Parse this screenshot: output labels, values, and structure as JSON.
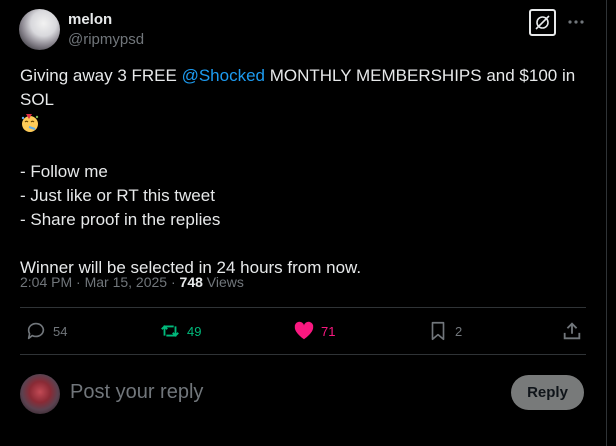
{
  "author": {
    "name": "melon",
    "handle": "@ripmypsd"
  },
  "tweet": {
    "line1_before": "Giving away 3 FREE ",
    "mention": "@Shocked",
    "line1_after": " MONTHLY MEMBERSHIPS and $100 in SOL",
    "bullet1": "- Follow me",
    "bullet2": "- Just like or RT this tweet",
    "bullet3": "- Share proof in the replies",
    "closing": "Winner will be selected in 24 hours from now."
  },
  "meta": {
    "timestamp": "2:04 PM · Mar 15, 2025 · ",
    "views_count": "748",
    "views_label": " Views"
  },
  "actions": {
    "replies": "54",
    "reposts": "49",
    "likes": "71",
    "bookmarks": "2"
  },
  "reply_box": {
    "placeholder": "Post your reply",
    "button_label": "Reply"
  },
  "colors": {
    "mention": "#1d9bf0",
    "repost": "#00ba7c",
    "like": "#f91880",
    "muted": "#71767b"
  },
  "icons": [
    "grok-icon",
    "more-icon",
    "party-emoji",
    "reply-icon",
    "repost-icon",
    "heart-icon",
    "bookmark-icon",
    "share-icon"
  ]
}
